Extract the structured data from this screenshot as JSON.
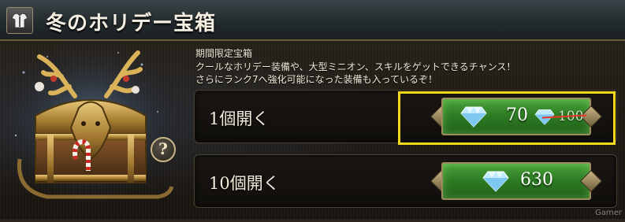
{
  "header": {
    "title": "冬のホリデー宝箱",
    "icon": "armor-icon"
  },
  "description": {
    "line1": "期間限定宝箱",
    "line2": "クールなホリデー装備や、大型ミニオン、スキルをゲットできるチャンス！",
    "line3": "さらにランク7へ強化可能になった装備も入っているぞ！"
  },
  "help": {
    "label": "?"
  },
  "options": [
    {
      "label": "1個開く",
      "price": "70",
      "original_price": "100",
      "currency_icon": "diamond-icon",
      "highlighted": true
    },
    {
      "label": "10個開く",
      "price": "630",
      "currency_icon": "diamond-icon",
      "highlighted": false
    }
  ],
  "colors": {
    "button_green": "#2f7e25",
    "highlight": "#f2d81a",
    "strike": "#e8352a"
  },
  "watermark": "Gamer"
}
